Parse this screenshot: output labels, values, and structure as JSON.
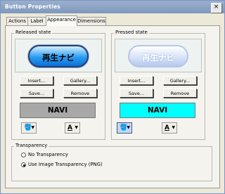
{
  "window": {
    "title": "Button Properties",
    "close_label": "×"
  },
  "tabs": [
    {
      "label": "Actions"
    },
    {
      "label": "Label"
    },
    {
      "label": "Appearance",
      "active": true
    },
    {
      "label": "Dimensions"
    }
  ],
  "released": {
    "group_label": "Released state",
    "preview_text": "再生ナビ",
    "buttons": {
      "insert": "Insert...",
      "gallery": "Gallery...",
      "save": "Save...",
      "remove": "Remove"
    },
    "label_bar": {
      "text": "NAVI",
      "color": "#a8a8a8"
    }
  },
  "pressed": {
    "group_label": "Pressed state",
    "preview_text": "再生ナビ",
    "buttons": {
      "insert": "Insert...",
      "gallery": "Gallery...",
      "save": "Save...",
      "remove": "Remove"
    },
    "label_bar": {
      "text": "NAVI",
      "color": "#00ffff"
    }
  },
  "icons": {
    "fill": "fill-color-icon",
    "text": "text-color-icon"
  },
  "transparency": {
    "group_label": "Transparency",
    "options": [
      {
        "label": "No Transparency",
        "selected": false
      },
      {
        "label": "Use Image Transparency (PNG)",
        "selected": true
      }
    ]
  }
}
